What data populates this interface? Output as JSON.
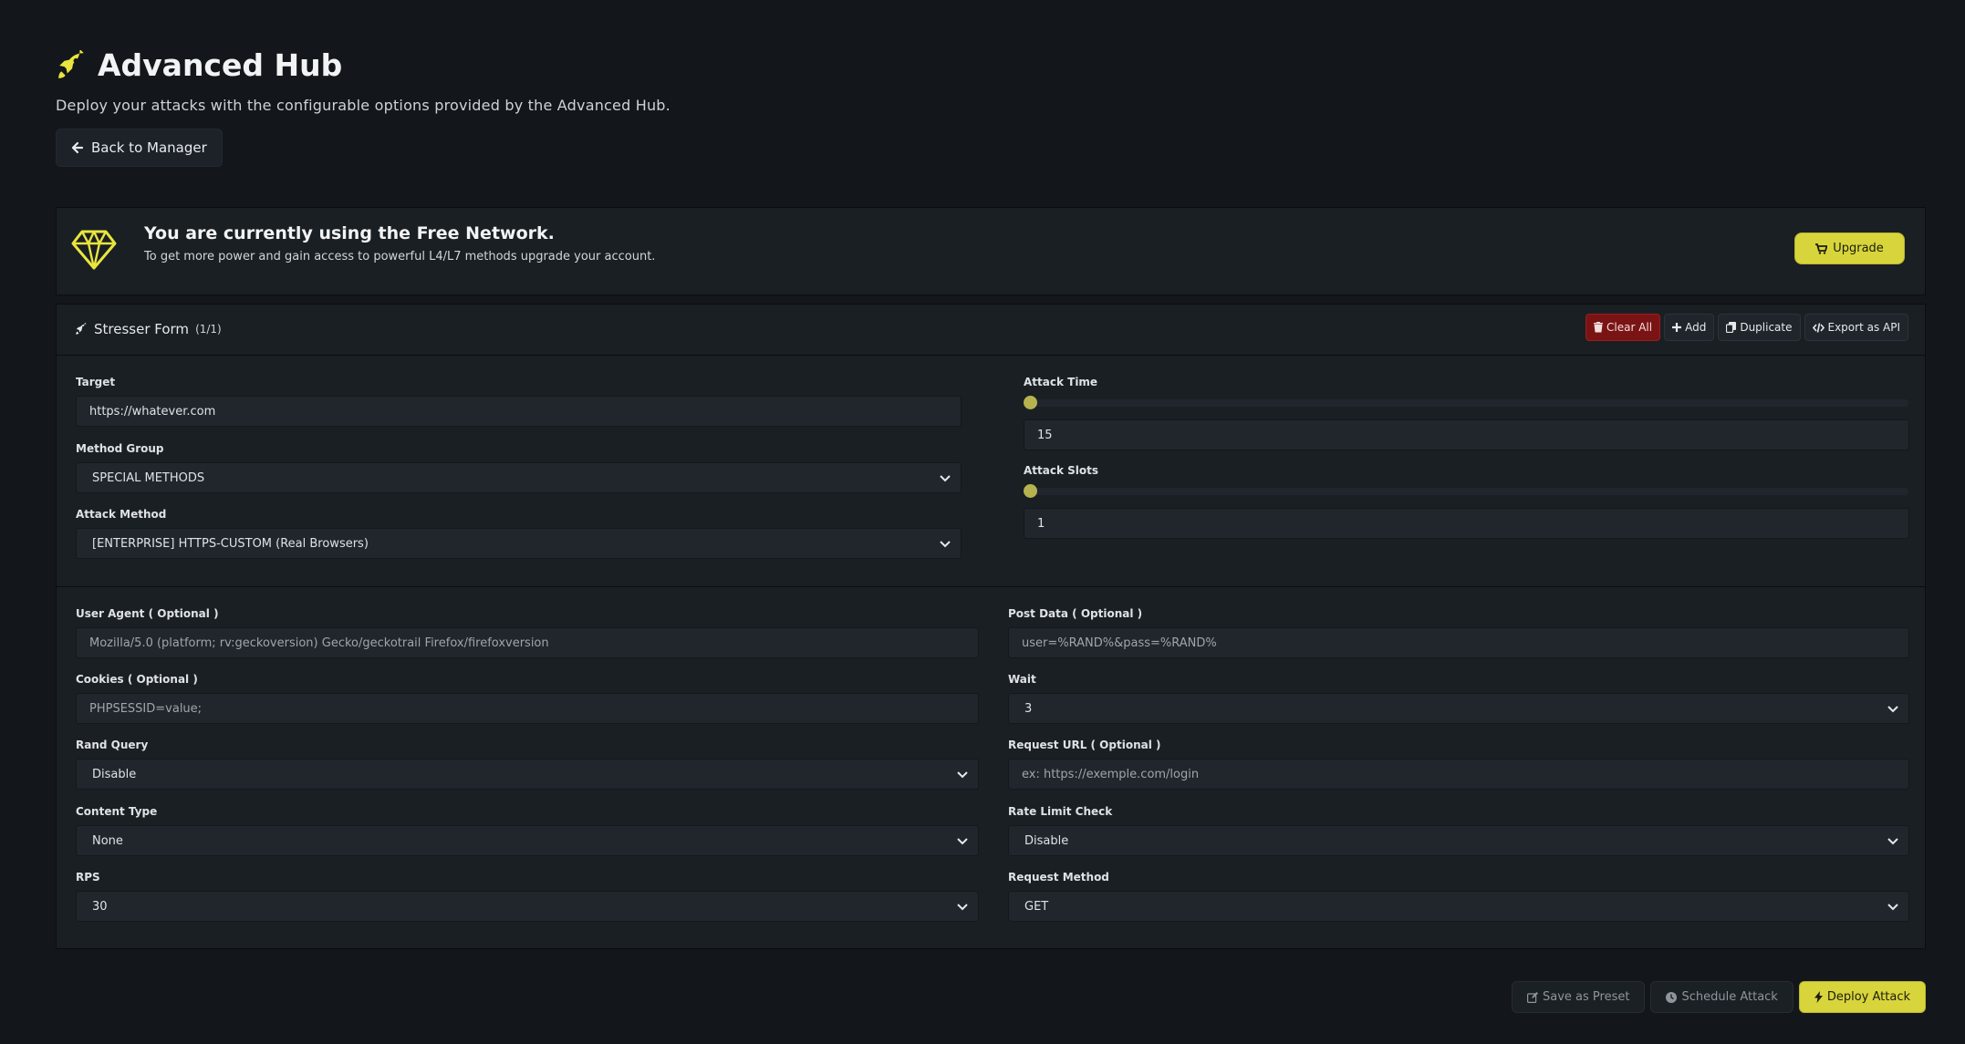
{
  "header": {
    "title": "Advanced Hub",
    "subtitle": "Deploy your attacks with the configurable options provided by the Advanced Hub.",
    "back_label": "Back to Manager"
  },
  "banner": {
    "title": "You are currently using the Free Network.",
    "description": "To get more power and gain access to powerful L4/L7 methods upgrade your account.",
    "upgrade_label": "Upgrade"
  },
  "form": {
    "title": "Stresser Form",
    "count": "(1/1)",
    "buttons": {
      "clear_all": "Clear All",
      "add": "Add",
      "duplicate": "Duplicate",
      "export": "Export as API"
    },
    "target": {
      "label": "Target",
      "value": "https://whatever.com"
    },
    "method_group": {
      "label": "Method Group",
      "value": "SPECIAL METHODS"
    },
    "attack_method": {
      "label": "Attack Method",
      "value": "[ENTERPRISE] HTTPS-CUSTOM (Real Browsers)"
    },
    "attack_time": {
      "label": "Attack Time",
      "value": "15"
    },
    "attack_slots": {
      "label": "Attack Slots",
      "value": "1"
    },
    "user_agent": {
      "label": "User Agent ( Optional )",
      "placeholder": "Mozilla/5.0 (platform; rv:geckoversion) Gecko/geckotrail Firefox/firefoxversion"
    },
    "post_data": {
      "label": "Post Data ( Optional )",
      "placeholder": "user=%RAND%&pass=%RAND%"
    },
    "cookies": {
      "label": "Cookies ( Optional )",
      "placeholder": "PHPSESSID=value;"
    },
    "wait": {
      "label": "Wait",
      "value": "3"
    },
    "rand_query": {
      "label": "Rand Query",
      "value": "Disable"
    },
    "request_url": {
      "label": "Request URL ( Optional )",
      "placeholder": "ex: https://exemple.com/login"
    },
    "content_type": {
      "label": "Content Type",
      "value": "None"
    },
    "rate_limit": {
      "label": "Rate Limit Check",
      "value": "Disable"
    },
    "rps": {
      "label": "RPS",
      "value": "30"
    },
    "request_method": {
      "label": "Request Method",
      "value": "GET"
    }
  },
  "footer": {
    "save_preset": "Save as Preset",
    "schedule": "Schedule Attack",
    "deploy": "Deploy Attack"
  },
  "colors": {
    "accent": "#d8d43b",
    "background": "#13171c",
    "panel": "#1a1f24",
    "danger": "#7a1414"
  }
}
